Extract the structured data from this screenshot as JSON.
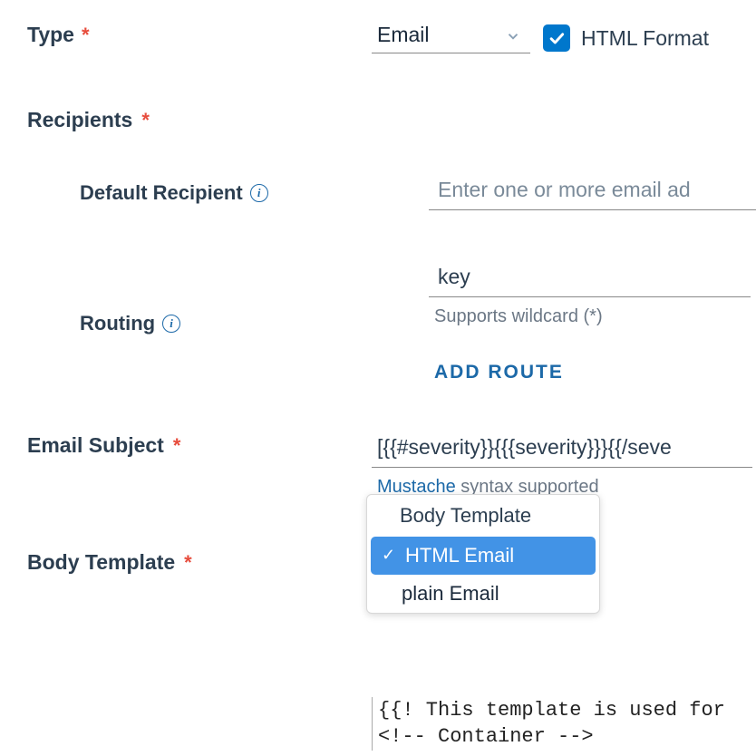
{
  "type": {
    "label": "Type",
    "value": "Email",
    "html_format_label": "HTML Format",
    "html_format_checked": true
  },
  "recipients": {
    "label": "Recipients",
    "default_recipient": {
      "label": "Default Recipient",
      "placeholder": "Enter one or more email ad"
    },
    "routing": {
      "label": "Routing",
      "value": "key",
      "helper": "Supports wildcard (*)",
      "add_route_label": "ADD ROUTE"
    }
  },
  "email_subject": {
    "label": "Email Subject",
    "value": "[{{#severity}}{{{severity}}}{{/seve",
    "helper_link": "Mustache",
    "helper_text": " syntax supported"
  },
  "body_template": {
    "label": "Body Template",
    "dropdown": {
      "header": "Body Template",
      "option1": "HTML Email",
      "option2": "plain Email"
    },
    "code_line1": "{{! This template is used for",
    "code_line2": "<!-- Container -->"
  }
}
